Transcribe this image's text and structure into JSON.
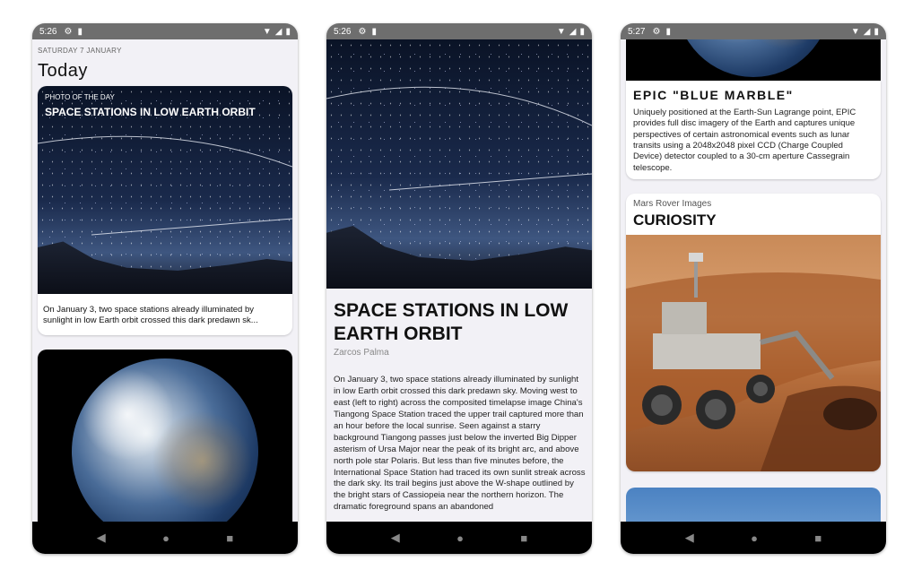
{
  "phones": [
    {
      "status": {
        "time": "5:26"
      },
      "date_line": "SATURDAY 7 JANUARY",
      "heading": "Today",
      "potd": {
        "label": "PHOTO OF THE DAY",
        "title": "SPACE STATIONS IN LOW EARTH ORBIT",
        "excerpt_line1": "On January 3, two space stations already illuminated by",
        "excerpt_line2": "sunlight in low Earth orbit crossed this dark predawn sk..."
      }
    },
    {
      "status": {
        "time": "5:26"
      },
      "article": {
        "title": "SPACE STATIONS IN LOW EARTH ORBIT",
        "author": "Zarcos Palma",
        "body": "On January 3, two space stations already illuminated by sunlight in low Earth orbit crossed this dark predawn sky. Moving west to east (left to right) across the composited timelapse image China's Tiangong Space Station traced the upper trail captured more than an hour before the local sunrise. Seen against a starry background Tiangong passes just below the inverted Big Dipper asterism of Ursa Major near the peak of its bright arc, and above north pole star Polaris. But less than five minutes before, the International Space Station had traced its own sunlit streak across the dark sky. Its trail begins just above the W-shape outlined by the bright stars of Cassiopeia near the northern horizon. The dramatic foreground spans an abandoned"
      }
    },
    {
      "status": {
        "time": "5:27"
      },
      "epic": {
        "title": "EPIC \"BLUE MARBLE\"",
        "description": "Uniquely positioned at the Earth-Sun Lagrange point, EPIC provides full disc imagery of the Earth and captures unique perspectives of certain astronomical events such as lunar transits using a 2048x2048 pixel CCD (Charge Coupled Device) detector coupled to a 30-cm aperture Cassegrain telescope."
      },
      "mars": {
        "label": "Mars Rover Images",
        "title": "CURIOSITY"
      }
    }
  ],
  "nav": {
    "back": "◀",
    "home": "●",
    "recents": "■"
  },
  "icons": {
    "settings": "gear-icon",
    "sim": "sim-card-icon",
    "wifi": "wifi-icon",
    "signal": "signal-icon",
    "battery": "battery-icon"
  }
}
